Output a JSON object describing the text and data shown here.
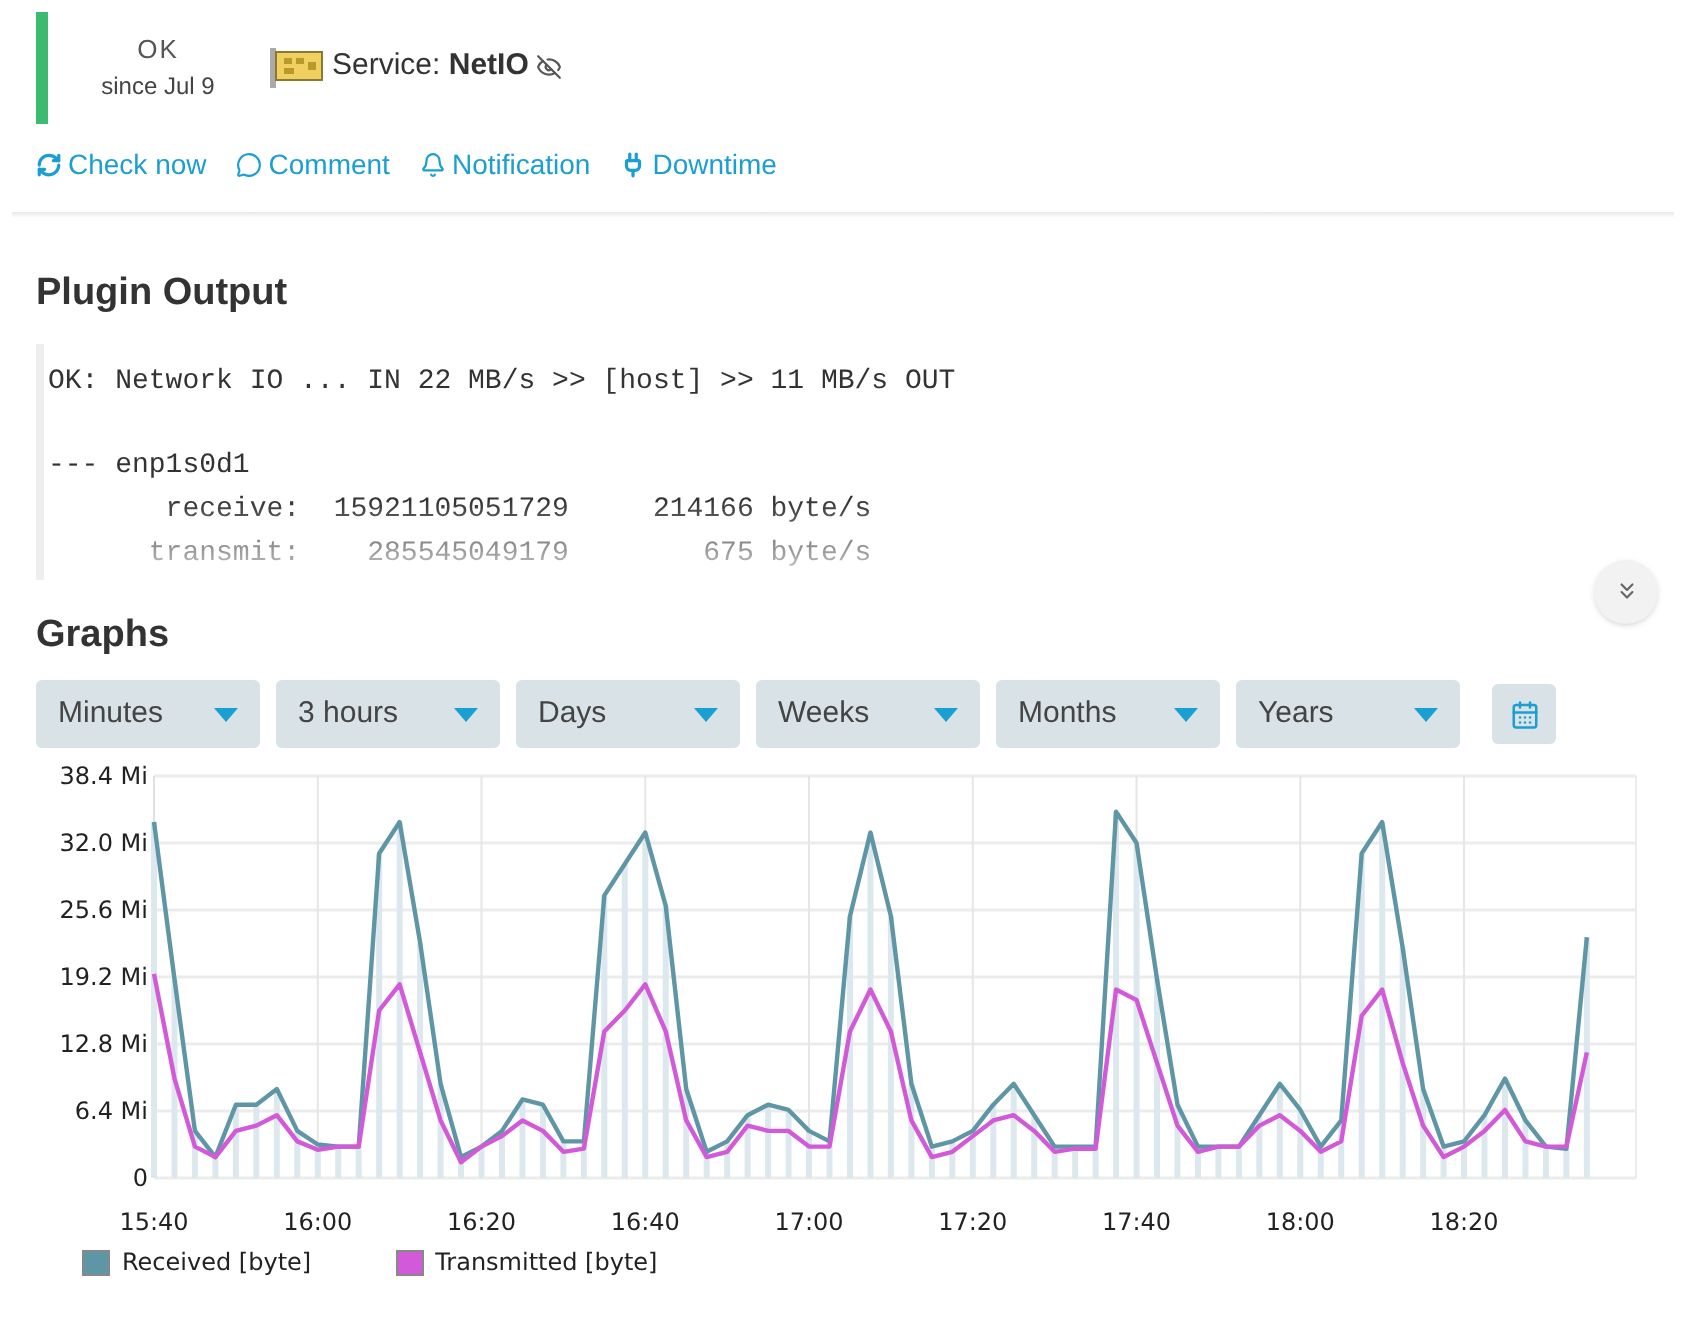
{
  "status": {
    "state": "OK",
    "since": "since Jul 9",
    "color": "#3cba6f"
  },
  "service": {
    "label": "Service: **NetIO**"
  },
  "actions": [
    {
      "label": "Check now",
      "kind": "refresh"
    },
    {
      "label": "Comment",
      "kind": "comment"
    },
    {
      "label": "Notification",
      "kind": "bell"
    },
    {
      "label": "Downtime",
      "kind": "plug"
    }
  ],
  "plugin_output": {
    "title": "Plugin Output",
    "collapsed": true,
    "summary": "OK: Network IO ... IN 22 MB/s >> [host] >> 11 MB/s OUT",
    "details": [
      "--- enp1s0d1",
      "       receive:  15921105051729     214166 byte/s",
      "      transmit:    285545049179        675 byte/s"
    ]
  },
  "graphs": {
    "title": "Graphs",
    "ranges": [
      "Minutes",
      "3 hours",
      "Days",
      "Weeks",
      "Months",
      "Years"
    ],
    "chart_data": {
      "type": "line",
      "ylim": [
        0,
        38.4
      ],
      "grid": true,
      "legend": "bottom",
      "categories": [
        "15:40",
        null,
        null,
        null,
        null,
        null,
        null,
        null,
        "16:00",
        null,
        null,
        null,
        null,
        null,
        null,
        null,
        "16:20",
        null,
        null,
        null,
        null,
        null,
        null,
        null,
        "16:40",
        null,
        null,
        null,
        null,
        null,
        null,
        null,
        "17:00",
        null,
        null,
        null,
        null,
        null,
        null,
        null,
        "17:20",
        null,
        null,
        null,
        null,
        null,
        null,
        null,
        "17:40",
        null,
        null,
        null,
        null,
        null,
        null,
        null,
        "18:00",
        null,
        null,
        null,
        null,
        null,
        null,
        null,
        "18:20",
        null,
        null,
        null,
        null,
        null,
        null
      ],
      "yticks": [
        {
          "value": 0,
          "label": "0"
        },
        {
          "value": 6.4,
          "label": "6.4 Mi"
        },
        {
          "value": 12.8,
          "label": "12.8 Mi"
        },
        {
          "value": 19.2,
          "label": "19.2 Mi"
        },
        {
          "value": 25.6,
          "label": "25.6 Mi"
        },
        {
          "value": 32,
          "label": "32.0 Mi"
        },
        {
          "value": 38.4,
          "label": "38.4 Mi"
        }
      ],
      "series": [
        {
          "type": "bar",
          "color": "#dde8ee",
          "values": [
            34,
            19,
            4.5,
            2,
            7,
            7,
            8.5,
            4.5,
            3.2,
            3,
            3,
            31,
            34,
            22.5,
            9,
            2,
            3,
            4.5,
            7.5,
            7,
            3.5,
            3.5,
            27,
            30,
            33,
            26,
            8.5,
            2.5,
            3.5,
            6,
            7,
            6.5,
            4.5,
            3.5,
            25,
            33,
            25,
            9,
            3,
            3.5,
            4.5,
            7,
            9,
            6,
            3,
            3,
            3,
            35,
            32,
            19,
            7,
            3,
            3,
            3,
            6,
            9,
            6.5,
            3,
            5.5,
            31,
            34,
            22,
            8.5,
            3,
            3.5,
            6,
            9.5,
            5.5,
            3,
            2.8,
            23
          ]
        },
        {
          "name": "Received [byte]",
          "color": "#5f96a6",
          "values": [
            34,
            19,
            4.5,
            2,
            7,
            7,
            8.5,
            4.5,
            3.2,
            3,
            3,
            31,
            34,
            22.5,
            9,
            2,
            3,
            4.5,
            7.5,
            7,
            3.5,
            3.5,
            27,
            30,
            33,
            26,
            8.5,
            2.5,
            3.5,
            6,
            7,
            6.5,
            4.5,
            3.5,
            25,
            33,
            25,
            9,
            3,
            3.5,
            4.5,
            7,
            9,
            6,
            3,
            3,
            3,
            35,
            32,
            19,
            7,
            3,
            3,
            3,
            6,
            9,
            6.5,
            3,
            5.5,
            31,
            34,
            22,
            8.5,
            3,
            3.5,
            6,
            9.5,
            5.5,
            3,
            2.8,
            23
          ]
        },
        {
          "name": "Transmitted [byte]",
          "color": "#d25ad9",
          "values": [
            19.5,
            9.5,
            3,
            2,
            4.5,
            5,
            6,
            3.5,
            2.7,
            3,
            3,
            16,
            18.5,
            12,
            5.5,
            1.5,
            3,
            4,
            5.5,
            4.5,
            2.5,
            2.8,
            14,
            16,
            18.5,
            14,
            5.5,
            2,
            2.5,
            5,
            4.5,
            4.5,
            3,
            3,
            14,
            18,
            14,
            5.5,
            2,
            2.5,
            4,
            5.5,
            6,
            4.5,
            2.5,
            2.8,
            2.8,
            18,
            17,
            11,
            5,
            2.5,
            3,
            3,
            5,
            6,
            4.5,
            2.5,
            3.5,
            15.5,
            18,
            11,
            5,
            2,
            3,
            4.5,
            6.5,
            3.5,
            3,
            3,
            12
          ]
        }
      ]
    }
  }
}
